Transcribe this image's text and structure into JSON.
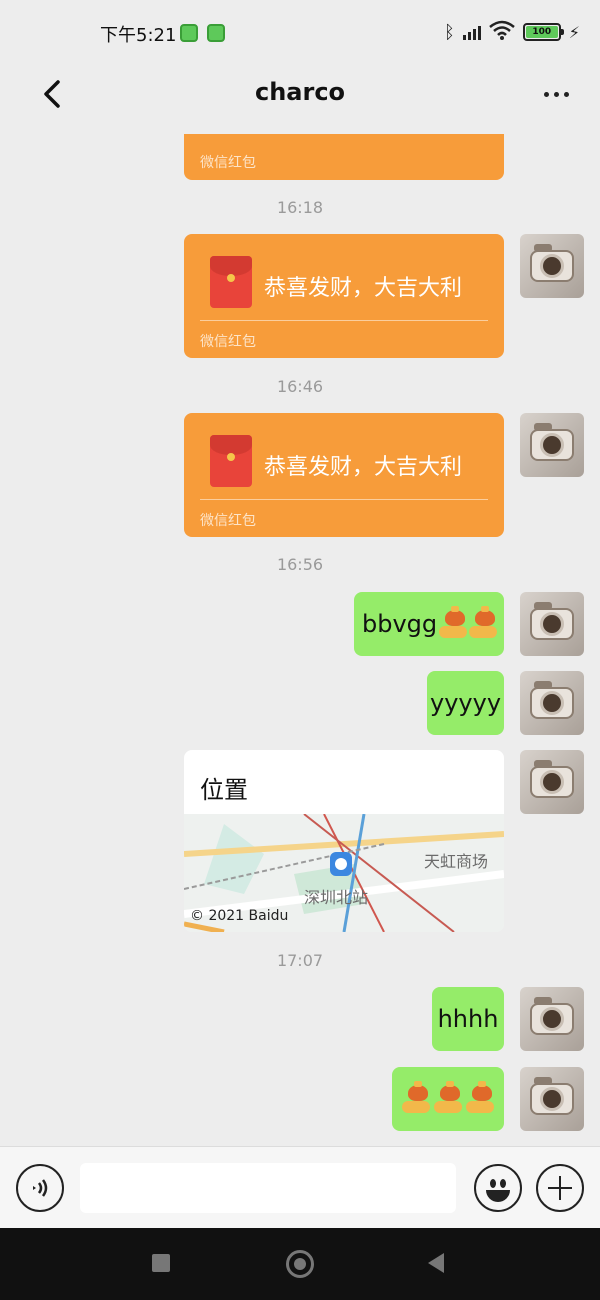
{
  "status_bar": {
    "time": "下午5:21",
    "battery": "100"
  },
  "header": {
    "title": "charco"
  },
  "messages": {
    "partial_packet_label": "微信红包",
    "ts1": "16:18",
    "packet1_text": "恭喜发财，大吉大利",
    "packet1_label": "微信红包",
    "ts2": "16:46",
    "packet2_text": "恭喜发财，大吉大利",
    "packet2_label": "微信红包",
    "ts3": "16:56",
    "msg1": "bbvgg",
    "msg2": "yyyyy",
    "location_title": "位置",
    "map_place_a": "天虹商场",
    "map_place_b": "深圳北站",
    "map_credit": "© 2021 Baidu",
    "ts4": "17:07",
    "msg3": "hhhh"
  },
  "input": {
    "placeholder": ""
  },
  "icons": {
    "back": "chevron-left-icon",
    "more": "more-dots-icon",
    "voice": "voice-icon",
    "emoji": "smiley-icon",
    "plus": "plus-icon",
    "red_packet": "red-packet-icon",
    "emoji_sticker": "fist-bump-emoji"
  },
  "colors": {
    "packet": "#f79c3a",
    "sent_bubble": "#95ec69",
    "chat_bg": "#ededed"
  }
}
